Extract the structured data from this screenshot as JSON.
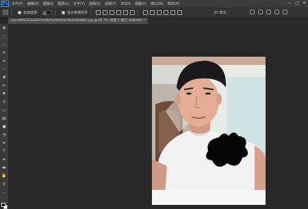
{
  "app": {
    "logo": "Ps"
  },
  "menu": [
    "文件(F)",
    "编辑(E)",
    "图像(I)",
    "图层(L)",
    "文字(Y)",
    "选择(S)",
    "滤镜(T)",
    "3D(D)",
    "视图(V)",
    "窗口(W)",
    "帮助(H)"
  ],
  "window_controls": {
    "minimize": "—",
    "maximize": "□",
    "close": "✕"
  },
  "options": {
    "auto_select_label": "自动选择：",
    "auto_select_value": "组",
    "transform_label": "显示变换控件",
    "mode_3d": "3D 模式："
  },
  "document": {
    "tab_title": "a1ec08fa513d2697dc5b55c950fbb2fb4216d89e.jpg @ 66.7% (背景 1 拷贝, RGB/8#) *"
  },
  "colors": {
    "foreground": "#000000",
    "background": "#ffffff"
  }
}
